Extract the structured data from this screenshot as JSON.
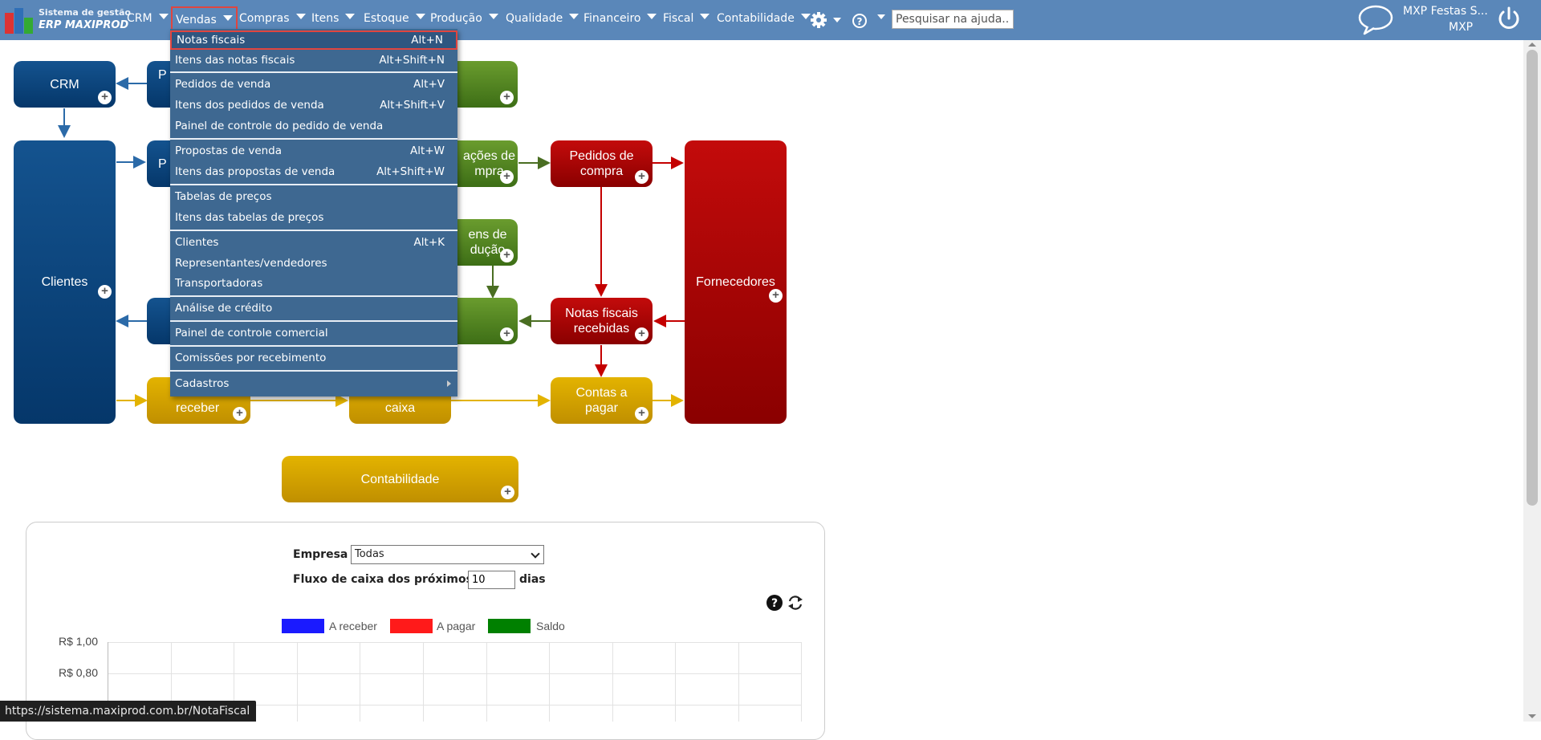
{
  "brand": {
    "line1": "Sistema de gestão",
    "line2": "ERP MAXIPROD"
  },
  "nav": {
    "items": [
      "CRM",
      "Vendas",
      "Compras",
      "Itens",
      "Estoque",
      "Produção",
      "Qualidade",
      "Financeiro",
      "Fiscal",
      "Contabilidade"
    ],
    "search_placeholder": "Pesquisar na ajuda...",
    "user_name": "MXP Festas S...",
    "user_code": "MXP"
  },
  "vendas_menu": {
    "items": [
      {
        "label": "Notas fiscais",
        "shortcut": "Alt+N"
      },
      {
        "label": "Itens das notas fiscais",
        "shortcut": "Alt+Shift+N"
      },
      {
        "label": "Pedidos de venda",
        "shortcut": "Alt+V"
      },
      {
        "label": "Itens dos pedidos de venda",
        "shortcut": "Alt+Shift+V"
      },
      {
        "label": "Painel de controle do pedido de venda",
        "shortcut": ""
      },
      {
        "label": "Propostas de venda",
        "shortcut": "Alt+W"
      },
      {
        "label": "Itens das propostas de venda",
        "shortcut": "Alt+Shift+W"
      },
      {
        "label": "Tabelas de preços",
        "shortcut": ""
      },
      {
        "label": "Itens das tabelas de preços",
        "shortcut": ""
      },
      {
        "label": "Clientes",
        "shortcut": "Alt+K"
      },
      {
        "label": "Representantes/vendedores",
        "shortcut": ""
      },
      {
        "label": "Transportadoras",
        "shortcut": ""
      },
      {
        "label": "Análise de crédito",
        "shortcut": ""
      },
      {
        "label": "Painel de controle comercial",
        "shortcut": ""
      },
      {
        "label": "Comissões por recebimento",
        "shortcut": ""
      },
      {
        "label": "Cadastros",
        "shortcut": ""
      }
    ]
  },
  "diagram": {
    "crm": "CRM",
    "p_top": "P",
    "clientes": "Clientes",
    "p_mid": "P",
    "solic_compra": "ações de\nmpra",
    "pedidos_compra": "Pedidos de\ncompra",
    "ordens_producao": "ens de\ndução",
    "notas_recebidas": "Notas fiscais\nrecebidas",
    "fornecedores": "Fornecedores",
    "contas_receber": "receber",
    "caixa": "caixa",
    "contas_pagar": "Contas a\npagar",
    "contabilidade": "Contabilidade"
  },
  "cashflow": {
    "empresa_label": "Empresa",
    "empresa_value": "Todas",
    "fluxo_label": "Fluxo de caixa dos próximos",
    "dias_value": "10",
    "dias_label": "dias",
    "legend": [
      {
        "name": "A receber",
        "color": "#1a1aff"
      },
      {
        "name": "A pagar",
        "color": "#ff1a1a"
      },
      {
        "name": "Saldo",
        "color": "#008000"
      }
    ],
    "yticks": [
      "R$ 1,00",
      "R$ 0,80"
    ]
  },
  "status_url": "https://sistema.maxiprod.com.br/NotaFiscal",
  "colors": {
    "topbar": "#5a87b9",
    "menu": "#3e6891",
    "highlight": "#e0453f"
  }
}
